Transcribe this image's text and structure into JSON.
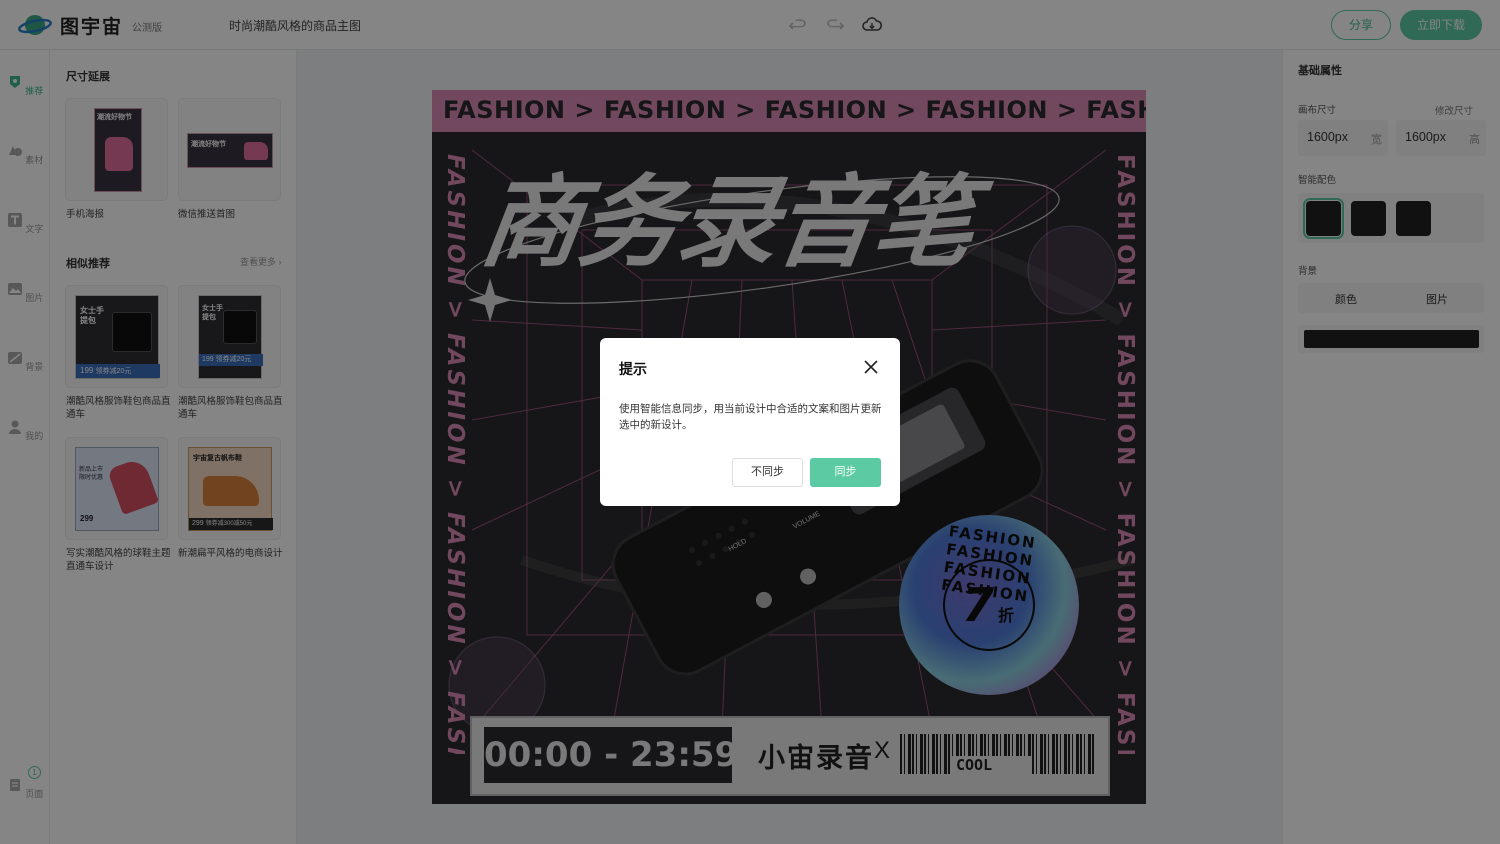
{
  "app": {
    "logo_text": "图宇宙",
    "beta_label": "公测版",
    "doc_title": "时尚潮酷风格的商品主图",
    "share_label": "分享",
    "download_label": "立即下载",
    "accent_color": "#5ccaa3"
  },
  "rail": {
    "items": [
      {
        "label": "推荐",
        "icon": "template-icon"
      },
      {
        "label": "素材",
        "icon": "shapes-icon"
      },
      {
        "label": "文字",
        "icon": "text-icon"
      },
      {
        "label": "图片",
        "icon": "image-icon"
      },
      {
        "label": "背景",
        "icon": "background-icon"
      },
      {
        "label": "我的",
        "icon": "user-icon"
      }
    ],
    "pages_label": "页面",
    "pages_badge": "1"
  },
  "left_panel": {
    "size_section_title": "尺寸延展",
    "size_items": [
      {
        "caption": "手机海报",
        "thumb_title": "潮流好物节"
      },
      {
        "caption": "微信推送首图",
        "thumb_title": "潮流好物节"
      }
    ],
    "similar_section_title": "相似推荐",
    "more_label": "查看更多",
    "similar_items": [
      {
        "caption": "潮酷风格服饰鞋包商品直通车",
        "thumb_title": "女士手提包",
        "price": "199",
        "promo": "领券减20元"
      },
      {
        "caption": "潮酷风格服饰鞋包商品直通车",
        "thumb_title": "女士手提包",
        "price": "199",
        "promo": "领券减20元"
      },
      {
        "caption": "写实潮酷风格的球鞋主题直通车设计",
        "thumb_title": "新品上市 限时优惠",
        "price": "299",
        "promo": ""
      },
      {
        "caption": "新潮扁平风格的电商设计",
        "thumb_title": "宇宙复古帆布鞋",
        "price": "299",
        "promo": "领券减300减50元"
      }
    ]
  },
  "poster": {
    "top_band": "FASHION > FASHION > FASHION > FASHION > FASHION >",
    "side_text": "FASHION > FASHION > FASHION > FASHION >",
    "headline": "商务录音笔",
    "time_range": "00:00 - 23:59",
    "brand": "小宙录音",
    "x_mark": "X",
    "barcode_label": "COOL",
    "badge_ring": "FASHION FASHION FASHION FASHION",
    "badge_number": "7",
    "badge_unit": "折",
    "device_labels": [
      "HOLD",
      "VOLUME"
    ],
    "band_color": "#d88bb4"
  },
  "right_panel": {
    "title": "基础属性",
    "canvas_size_label": "画布尺寸",
    "modify_size_label": "修改尺寸",
    "width_value": "1600px",
    "width_unit": "宽",
    "height_value": "1600px",
    "height_unit": "高",
    "smart_color_label": "智能配色",
    "background_label": "背景",
    "bg_tab_color": "颜色",
    "bg_tab_image": "图片",
    "bg_color": "#222222"
  },
  "dialog": {
    "title": "提示",
    "message": "使用智能信息同步，用当前设计中合适的文案和图片更新选中的新设计。",
    "cancel_label": "不同步",
    "confirm_label": "同步"
  }
}
